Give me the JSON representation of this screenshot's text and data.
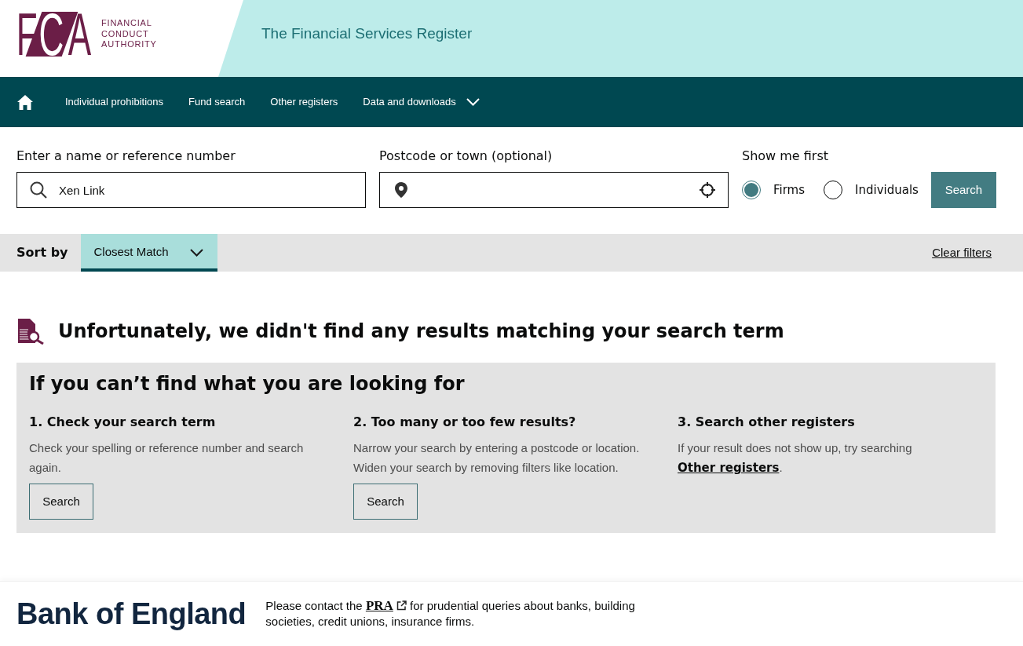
{
  "header": {
    "logo": {
      "mark": "FCA",
      "name_lines": [
        "FINANCIAL",
        "CONDUCT",
        "AUTHORITY"
      ]
    },
    "title": "The Financial Services Register"
  },
  "nav": {
    "items": [
      {
        "kind": "home"
      },
      {
        "kind": "link",
        "label": "Individual prohibitions"
      },
      {
        "kind": "link",
        "label": "Fund search"
      },
      {
        "kind": "link",
        "label": "Other registers"
      },
      {
        "kind": "dropdown",
        "label": "Data and downloads"
      }
    ]
  },
  "search": {
    "name_field": {
      "label": "Enter a name or reference number",
      "value": "Xen Link"
    },
    "location_field": {
      "label": "Postcode or town (optional)"
    },
    "show_me_first": {
      "label": "Show me first",
      "options": [
        {
          "label": "Firms",
          "selected": true
        },
        {
          "label": "Individuals",
          "selected": false
        }
      ]
    },
    "button": "Search"
  },
  "sort_bar": {
    "label": "Sort by",
    "value": "Closest Match",
    "clear_filters": "Clear filters"
  },
  "results": {
    "message": "Unfortunately, we didn't find any results matching your search term",
    "help": {
      "title": "If you can’t find what you are looking for",
      "columns": [
        {
          "heading": "1. Check your search term",
          "text": "Check your spelling or reference number and search again.",
          "button": "Search"
        },
        {
          "heading": "2. Too many or too few results?",
          "text": "Narrow your search by entering a postcode or location. Widen your search by removing filters like location.",
          "button": "Search"
        },
        {
          "heading": "3. Search other registers",
          "text": "If your result does not show up, try searching",
          "link": "Other registers",
          "after": "."
        }
      ]
    }
  },
  "footer": {
    "logo": "Bank of England",
    "notice": {
      "before": "Please contact the",
      "link": "PRA",
      "after": "for prudential queries about banks, building societies, credit unions, insurance firms."
    }
  }
}
